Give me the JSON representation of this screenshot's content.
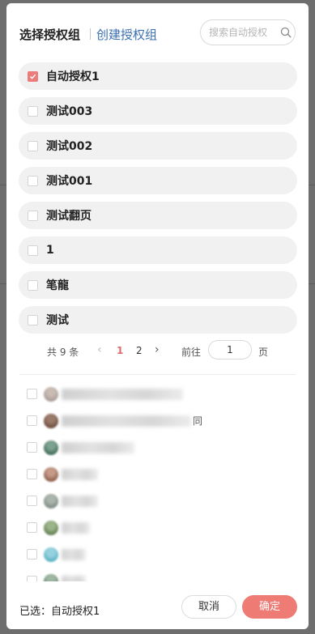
{
  "header": {
    "title": "选择授权组",
    "create_link": "创建授权组",
    "search_placeholder": "搜索自动授权"
  },
  "groups": [
    {
      "label": "自动授权1",
      "checked": true
    },
    {
      "label": "测试003",
      "checked": false
    },
    {
      "label": "测试002",
      "checked": false
    },
    {
      "label": "测试001",
      "checked": false
    },
    {
      "label": "测试翻页",
      "checked": false
    },
    {
      "label": "1",
      "checked": false
    },
    {
      "label": "笔龍",
      "checked": false
    },
    {
      "label": "测试",
      "checked": false
    }
  ],
  "pagination": {
    "total": "共 9 条",
    "pages": [
      "1",
      "2"
    ],
    "current_page": "1",
    "goto_label": "前往",
    "goto_value": "1",
    "page_suffix": "页"
  },
  "users": [
    {
      "name_suffix": ""
    },
    {
      "name_suffix": "同"
    },
    {
      "name_suffix": ""
    },
    {
      "name_suffix": ""
    },
    {
      "name_suffix": ""
    },
    {
      "name_suffix": ""
    },
    {
      "name_suffix": ""
    },
    {
      "name_suffix": ""
    }
  ],
  "footer": {
    "selected": "已选：自动授权1",
    "cancel": "取消",
    "confirm": "确定"
  },
  "colors": {
    "accent": "#ee7b74",
    "link": "#3a6fb0",
    "checked": "#ec7c7c"
  }
}
